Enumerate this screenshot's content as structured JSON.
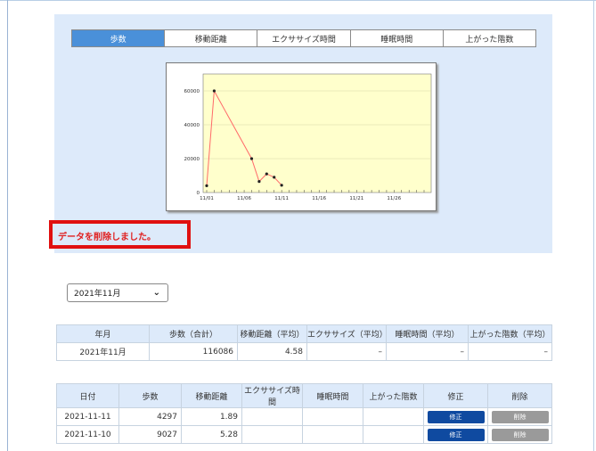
{
  "tabs": [
    "歩数",
    "移動距離",
    "エクササイズ時間",
    "睡眠時間",
    "上がった階数"
  ],
  "active_tab": "歩数",
  "message": "データを削除しました。",
  "month_select": {
    "value": "2021年11月"
  },
  "summary_table": {
    "headers": [
      "年月",
      "歩数（合計）",
      "移動距離（平均）",
      "エクササイズ（平均）",
      "睡眠時間（平均）",
      "上がった階数（平均）"
    ],
    "row": [
      "2021年11月",
      "116086",
      "4.58",
      "–",
      "–",
      "–"
    ]
  },
  "daily_table": {
    "headers": [
      "日付",
      "歩数",
      "移動距離",
      "エクササイズ時間",
      "睡眠時間",
      "上がった階数",
      "修正",
      "削除"
    ],
    "rows": [
      {
        "date": "2021-11-11",
        "steps": "4297",
        "distance": "1.89",
        "exercise": "",
        "sleep": "",
        "floors": "",
        "edit": "修正",
        "delete": "削除"
      },
      {
        "date": "2021-11-10",
        "steps": "9027",
        "distance": "5.28",
        "exercise": "",
        "sleep": "",
        "floors": "",
        "edit": "修正",
        "delete": "削除"
      }
    ]
  },
  "colors": {
    "tab_active": "#4a90d9",
    "panel_bg": "#ddeafa",
    "plot_bg": "#ffffcc",
    "line": "#ff6a6a",
    "alert": "#e01010",
    "edit_button": "#0f4aa0",
    "delete_button": "#9a9a9a"
  },
  "chart_data": {
    "type": "line",
    "x": [
      "11/01",
      "11/02",
      "11/06",
      "11/07",
      "11/08",
      "11/09",
      "11/10",
      "11/11"
    ],
    "values": [
      4000,
      60000,
      20000,
      6500,
      11000,
      9000,
      4300,
      null
    ],
    "points": [
      {
        "day": 1,
        "value": 4000
      },
      {
        "day": 2,
        "value": 60000
      },
      {
        "day": 7,
        "value": 20000
      },
      {
        "day": 8,
        "value": 6500
      },
      {
        "day": 9,
        "value": 11000
      },
      {
        "day": 10,
        "value": 9000
      },
      {
        "day": 11,
        "value": 4300
      }
    ],
    "x_tick_labels": [
      "11/01",
      "11/06",
      "11/11",
      "11/16",
      "11/21",
      "11/26"
    ],
    "y_tick_labels": [
      "0",
      "20000",
      "40000",
      "60000"
    ],
    "xlim": [
      1,
      30
    ],
    "ylim": [
      0,
      70000
    ],
    "grid": true,
    "title": "",
    "xlabel": "",
    "ylabel": ""
  }
}
